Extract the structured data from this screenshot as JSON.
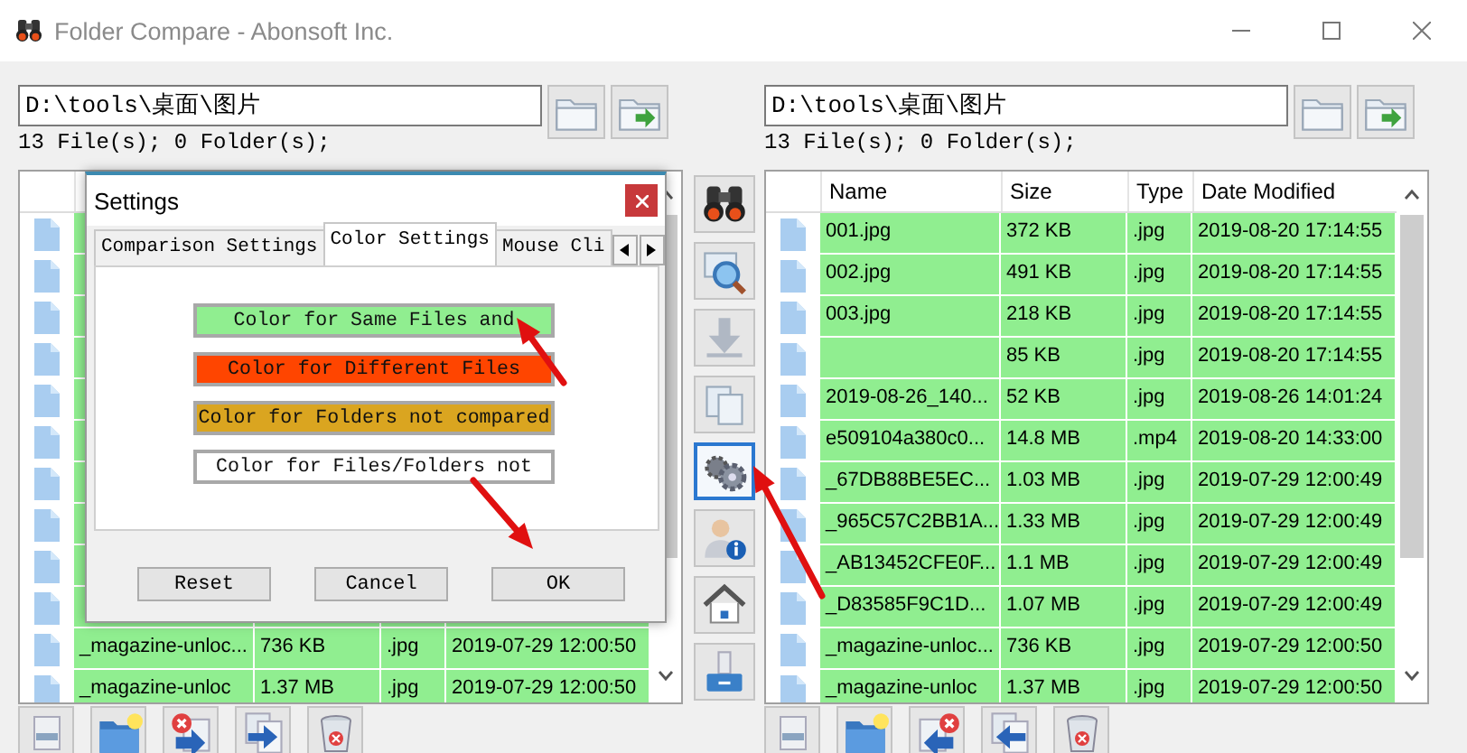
{
  "window": {
    "title": "Folder Compare - Abonsoft Inc."
  },
  "left_pane": {
    "path": "D:\\tools\\桌面\\图片",
    "summary": "13 File(s); 0 Folder(s);",
    "path_buttons": [
      {
        "kind": "folder"
      },
      {
        "kind": "folder-go"
      }
    ],
    "rows": [
      {
        "color": "#90ee90"
      },
      {
        "color": "#90ee90"
      },
      {
        "color": "#90ee90"
      },
      {
        "color": "#90ee90"
      },
      {
        "color": "#90ee90"
      },
      {
        "color": "#90ee90"
      },
      {
        "color": "#90ee90"
      },
      {
        "color": "#90ee90"
      },
      {
        "color": "#90ee90"
      },
      {
        "color": "#90ee90"
      },
      {
        "name": "_magazine-unloc...",
        "size": "736 KB",
        "type": ".jpg",
        "modified": "2019-07-29 12:00:50",
        "color": "#90ee90"
      },
      {
        "name": "_magazine-unloc",
        "size": "1.37 MB",
        "type": ".jpg",
        "modified": "2019-07-29 12:00:50",
        "color": "#90ee90"
      }
    ],
    "toolbar": [
      {
        "kind": "rename"
      },
      {
        "kind": "new-folder"
      },
      {
        "kind": "move-right"
      },
      {
        "kind": "copy-right"
      },
      {
        "kind": "delete"
      }
    ]
  },
  "tools": [
    {
      "kind": "binoculars",
      "selected": false
    },
    {
      "kind": "magnifier",
      "selected": false
    },
    {
      "kind": "download",
      "selected": false
    },
    {
      "kind": "documents",
      "selected": false
    },
    {
      "kind": "gears",
      "selected": true
    },
    {
      "kind": "user-info",
      "selected": false
    },
    {
      "kind": "home",
      "selected": false
    },
    {
      "kind": "drive",
      "selected": false
    }
  ],
  "right_pane": {
    "path": "D:\\tools\\桌面\\图片",
    "summary": "13 File(s); 0 Folder(s);",
    "path_buttons": [
      {
        "kind": "folder"
      },
      {
        "kind": "folder-go"
      }
    ],
    "columns": [
      "Name",
      "Size",
      "Type",
      "Date Modified"
    ],
    "rows": [
      {
        "name": "001.jpg",
        "size": "372 KB",
        "type": ".jpg",
        "modified": "2019-08-20 17:14:55",
        "color": "#90ee90"
      },
      {
        "name": "002.jpg",
        "size": "491 KB",
        "type": ".jpg",
        "modified": "2019-08-20 17:14:55",
        "color": "#90ee90"
      },
      {
        "name": "003.jpg",
        "size": "218 KB",
        "type": ".jpg",
        "modified": "2019-08-20 17:14:55",
        "color": "#90ee90"
      },
      {
        "size": "85 KB",
        "type": ".jpg",
        "modified": "2019-08-20 17:14:55",
        "color": "#90ee90"
      },
      {
        "name": "2019-08-26_140...",
        "size": "52 KB",
        "type": ".jpg",
        "modified": "2019-08-26 14:01:24",
        "color": "#90ee90"
      },
      {
        "name": "e509104a380c0...",
        "size": "14.8 MB",
        "type": ".mp4",
        "modified": "2019-08-20 14:33:00",
        "color": "#90ee90"
      },
      {
        "name": "_67DB88BE5EC...",
        "size": "1.03 MB",
        "type": ".jpg",
        "modified": "2019-07-29 12:00:49",
        "color": "#90ee90"
      },
      {
        "name": "_965C57C2BB1A...",
        "size": "1.33 MB",
        "type": ".jpg",
        "modified": "2019-07-29 12:00:49",
        "color": "#90ee90"
      },
      {
        "name": "_AB13452CFE0F...",
        "size": "1.1 MB",
        "type": ".jpg",
        "modified": "2019-07-29 12:00:49",
        "color": "#90ee90"
      },
      {
        "name": "_D83585F9C1D...",
        "size": "1.07 MB",
        "type": ".jpg",
        "modified": "2019-07-29 12:00:49",
        "color": "#90ee90"
      },
      {
        "name": "_magazine-unloc...",
        "size": "736 KB",
        "type": ".jpg",
        "modified": "2019-07-29 12:00:50",
        "color": "#90ee90"
      },
      {
        "name": "_magazine-unloc",
        "size": "1.37 MB",
        "type": ".jpg",
        "modified": "2019-07-29 12:00:50",
        "color": "#90ee90"
      }
    ],
    "toolbar": [
      {
        "kind": "rename"
      },
      {
        "kind": "new-folder"
      },
      {
        "kind": "move-left"
      },
      {
        "kind": "copy-left"
      },
      {
        "kind": "delete"
      }
    ]
  },
  "dialog": {
    "title": "Settings",
    "tabs": [
      {
        "label": "Comparison Settings",
        "selected": false
      },
      {
        "label": "Color Settings",
        "selected": true
      },
      {
        "label": "Mouse Cli",
        "selected": false
      }
    ],
    "color_buttons": [
      {
        "label": "Color for Same Files and",
        "color": "#90ee90"
      },
      {
        "label": "Color for Different Files",
        "color": "#ff4500"
      },
      {
        "label": "Color for Folders not compared",
        "color": "#daa520"
      },
      {
        "label": "Color for Files/Folders not",
        "color": "#ffffff"
      }
    ],
    "buttons": [
      "Reset",
      "Cancel",
      "OK"
    ]
  },
  "annotations": [
    {
      "kind": "arrow"
    },
    {
      "kind": "arrow"
    },
    {
      "kind": "arrow"
    }
  ]
}
